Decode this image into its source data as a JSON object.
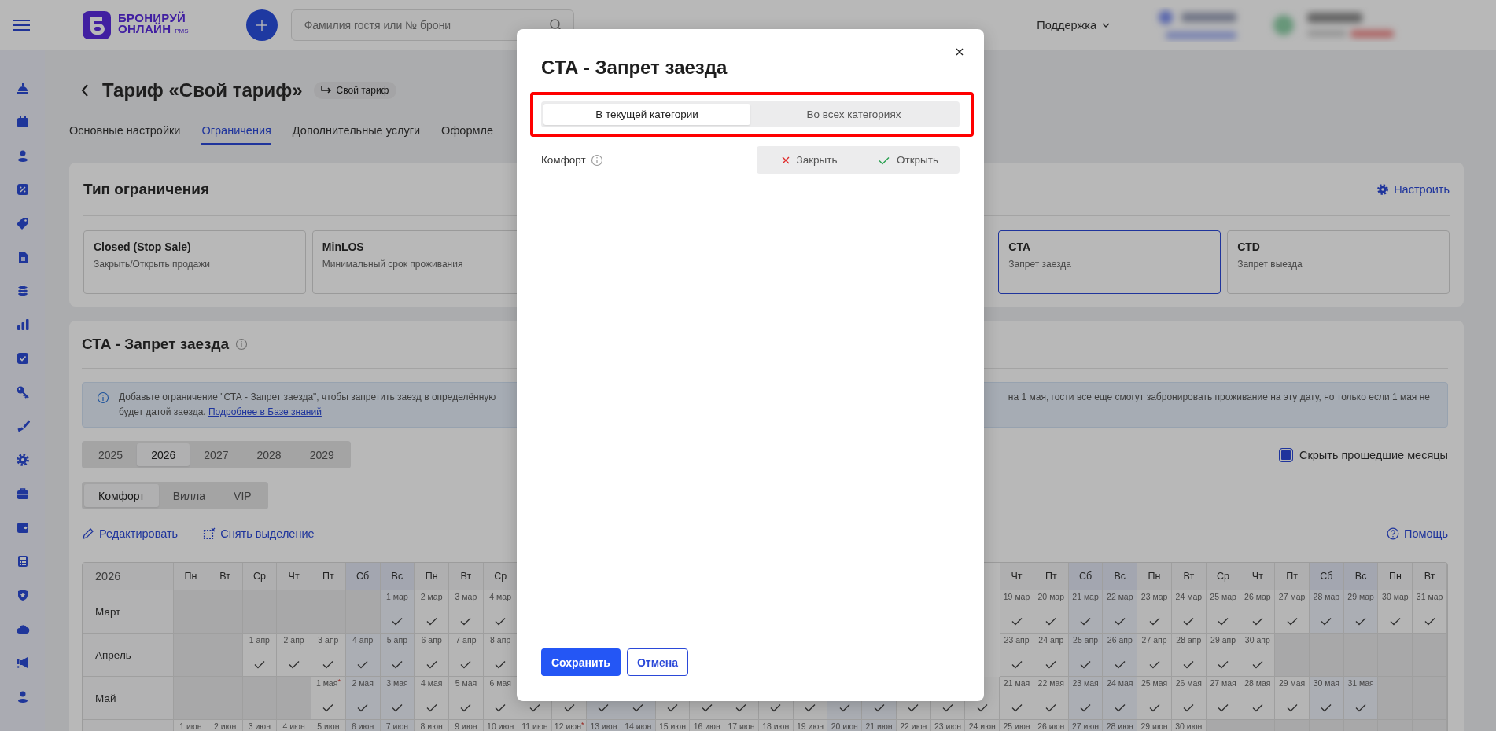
{
  "topbar": {
    "logo": {
      "line1": "БРОНИРУЙ",
      "line2": "ОНЛАЙН",
      "suffix": "PMS"
    },
    "search": {
      "placeholder": "Фамилия гостя или № брони"
    },
    "support": "Поддержка"
  },
  "page": {
    "title": "Тариф «Свой тариф»",
    "chip": "Свой тариф",
    "tabs": [
      {
        "label": "Основные настройки",
        "selected": false
      },
      {
        "label": "Ограничения",
        "selected": true
      },
      {
        "label": "Дополнительные услуги",
        "selected": false
      },
      {
        "label": "Оформле",
        "selected": false
      }
    ]
  },
  "restriction_types": {
    "title": "Тип ограничения",
    "configure": "Настроить",
    "cards_start": [
      {
        "title": "Closed (Stop Sale)",
        "description": "Закрыть/Открыть продажи",
        "selected": false
      },
      {
        "title": "MinLOS",
        "description": "Минимальный срок проживания",
        "selected": false
      }
    ],
    "cards_end": [
      {
        "title": "CTA",
        "description": "Запрет заезда",
        "selected": true
      },
      {
        "title": "CTD",
        "description": "Запрет выезда",
        "selected": false
      }
    ]
  },
  "restriction": {
    "title": "СТА - Запрет заезда",
    "info": {
      "line1_start": "Добавьте ограничение \"СТА - Запрет заезда\", чтобы запретить заезд в определённую",
      "line1_end": "на 1 мая, гости все еще смогут забронировать проживание на эту дату, но только если 1 мая не",
      "line2": "будет датой заезда.",
      "link": "Подробнее в Базе знаний"
    },
    "years": [
      {
        "label": "2025",
        "selected": false
      },
      {
        "label": "2026",
        "selected": true
      },
      {
        "label": "2027",
        "selected": false
      },
      {
        "label": "2028",
        "selected": false
      },
      {
        "label": "2029",
        "selected": false
      }
    ],
    "hide_past": {
      "label": "Скрыть прошедшие месяцы",
      "checked": true
    },
    "categories": [
      {
        "label": "Комфорт",
        "selected": true
      },
      {
        "label": "Вилла",
        "selected": false
      },
      {
        "label": "VIP",
        "selected": false
      }
    ],
    "edit": "Редактировать",
    "clear": "Снять выделение",
    "help": "Помощь",
    "calendar": {
      "year": "2026",
      "header_start": [
        {
          "day": "Пн",
          "weekend": false
        },
        {
          "day": "Вт",
          "weekend": false
        },
        {
          "day": "Ср",
          "weekend": false
        },
        {
          "day": "Чт",
          "weekend": false
        },
        {
          "day": "Пт",
          "weekend": false
        },
        {
          "day": "Сб",
          "weekend": true
        },
        {
          "day": "Вс",
          "weekend": true
        },
        {
          "day": "Пн",
          "weekend": false
        },
        {
          "day": "Вт",
          "weekend": false
        },
        {
          "day": "Ср",
          "weekend": false
        }
      ],
      "header_end": [
        {
          "day": "Чт",
          "weekend": false
        },
        {
          "day": "Пт",
          "weekend": false
        },
        {
          "day": "Сб",
          "weekend": true
        },
        {
          "day": "Вс",
          "weekend": true
        },
        {
          "day": "Пн",
          "weekend": false
        },
        {
          "day": "Вт",
          "weekend": false
        },
        {
          "day": "Ср",
          "weekend": false
        },
        {
          "day": "Чт",
          "weekend": false
        },
        {
          "day": "Пт",
          "weekend": false
        },
        {
          "day": "Сб",
          "weekend": true
        },
        {
          "day": "Вс",
          "weekend": true
        },
        {
          "day": "Пн",
          "weekend": false
        },
        {
          "day": "Вт",
          "weekend": false
        }
      ],
      "rows": [
        {
          "month": "Март",
          "cells": [
            {
              "kind": "empty"
            },
            {
              "kind": "empty"
            },
            {
              "kind": "empty"
            },
            {
              "kind": "empty"
            },
            {
              "kind": "empty"
            },
            {
              "kind": "empty"
            },
            {
              "kind": "day",
              "date": "1 мар",
              "checked": true,
              "weekend": true
            },
            {
              "kind": "day",
              "date": "2 мар",
              "checked": true
            },
            {
              "kind": "day",
              "date": "3 мар",
              "checked": true
            },
            {
              "kind": "day",
              "date": "4 мар",
              "checked": true
            }
          ],
          "cells_end": [
            {
              "kind": "day",
              "date": "19 мар",
              "checked": true
            },
            {
              "kind": "day",
              "date": "20 мар",
              "checked": true
            },
            {
              "kind": "day",
              "date": "21 мар",
              "checked": true,
              "weekend": true
            },
            {
              "kind": "day",
              "date": "22 мар",
              "checked": true,
              "weekend": true
            },
            {
              "kind": "day",
              "date": "23 мар",
              "checked": true
            },
            {
              "kind": "day",
              "date": "24 мар",
              "checked": true
            },
            {
              "kind": "day",
              "date": "25 мар",
              "checked": true
            },
            {
              "kind": "day",
              "date": "26 мар",
              "checked": true
            },
            {
              "kind": "day",
              "date": "27 мар",
              "checked": true
            },
            {
              "kind": "day",
              "date": "28 мар",
              "checked": true,
              "weekend": true
            },
            {
              "kind": "day",
              "date": "29 мар",
              "checked": true,
              "weekend": true
            },
            {
              "kind": "day",
              "date": "30 мар",
              "checked": true
            },
            {
              "kind": "day",
              "date": "31 мар",
              "checked": true
            }
          ]
        },
        {
          "month": "Апрель",
          "cells": [
            {
              "kind": "empty"
            },
            {
              "kind": "empty"
            },
            {
              "kind": "day",
              "date": "1 апр",
              "checked": true
            },
            {
              "kind": "day",
              "date": "2 апр",
              "checked": true
            },
            {
              "kind": "day",
              "date": "3 апр",
              "checked": true
            },
            {
              "kind": "day",
              "date": "4 апр",
              "checked": true,
              "weekend": true
            },
            {
              "kind": "day",
              "date": "5 апр",
              "checked": true,
              "weekend": true
            },
            {
              "kind": "day",
              "date": "6 апр",
              "checked": true
            },
            {
              "kind": "day",
              "date": "7 апр",
              "checked": true
            },
            {
              "kind": "day",
              "date": "8 апр",
              "checked": true
            }
          ],
          "cells_end": [
            {
              "kind": "day",
              "date": "23 апр",
              "checked": true
            },
            {
              "kind": "day",
              "date": "24 апр",
              "checked": true
            },
            {
              "kind": "day",
              "date": "25 апр",
              "checked": true,
              "weekend": true
            },
            {
              "kind": "day",
              "date": "26 апр",
              "checked": true,
              "weekend": true
            },
            {
              "kind": "day",
              "date": "27 апр",
              "checked": true
            },
            {
              "kind": "day",
              "date": "28 апр",
              "checked": true
            },
            {
              "kind": "day",
              "date": "29 апр",
              "checked": true
            },
            {
              "kind": "day",
              "date": "30 апр",
              "checked": true
            },
            {
              "kind": "empty"
            },
            {
              "kind": "empty"
            },
            {
              "kind": "empty"
            },
            {
              "kind": "empty"
            },
            {
              "kind": "empty"
            }
          ]
        },
        {
          "month": "Май",
          "cells": [
            {
              "kind": "empty"
            },
            {
              "kind": "empty"
            },
            {
              "kind": "empty"
            },
            {
              "kind": "empty"
            },
            {
              "kind": "day",
              "date": "1 мая",
              "mark": "*",
              "checked": true
            },
            {
              "kind": "day",
              "date": "2 мая",
              "checked": true,
              "weekend": true
            },
            {
              "kind": "day",
              "date": "3 мая",
              "checked": true,
              "weekend": true
            },
            {
              "kind": "day",
              "date": "4 мая",
              "checked": true
            },
            {
              "kind": "day",
              "date": "5 мая",
              "checked": true
            },
            {
              "kind": "day",
              "date": "6 мая",
              "checked": true
            },
            {
              "kind": "day",
              "checked": true
            },
            {
              "kind": "day",
              "checked": true
            },
            {
              "kind": "day",
              "checked": true,
              "weekend": true
            },
            {
              "kind": "day",
              "checked": true,
              "weekend": true
            },
            {
              "kind": "day",
              "checked": true
            },
            {
              "kind": "day",
              "checked": true
            },
            {
              "kind": "day",
              "checked": true
            },
            {
              "kind": "day",
              "checked": true
            },
            {
              "kind": "day",
              "checked": true
            },
            {
              "kind": "day",
              "checked": true,
              "weekend": true
            },
            {
              "kind": "day",
              "checked": true,
              "weekend": true
            },
            {
              "kind": "day",
              "checked": true
            },
            {
              "kind": "day",
              "checked": true
            },
            {
              "kind": "day",
              "checked": true
            },
            {
              "kind": "day",
              "date": "21 мая",
              "checked": true
            },
            {
              "kind": "day",
              "date": "22 мая",
              "checked": true
            },
            {
              "kind": "day",
              "date": "23 мая",
              "checked": true,
              "weekend": true
            },
            {
              "kind": "day",
              "date": "24 мая",
              "checked": true,
              "weekend": true
            },
            {
              "kind": "day",
              "date": "25 мая",
              "checked": true
            },
            {
              "kind": "day",
              "date": "26 мая",
              "checked": true
            },
            {
              "kind": "day",
              "date": "27 мая",
              "checked": true
            },
            {
              "kind": "day",
              "date": "28 мая",
              "checked": true
            },
            {
              "kind": "day",
              "date": "29 мая",
              "checked": true
            },
            {
              "kind": "day",
              "date": "30 мая",
              "checked": true,
              "weekend": true
            },
            {
              "kind": "day",
              "date": "31 мая",
              "checked": true,
              "weekend": true
            },
            {
              "kind": "empty"
            },
            {
              "kind": "empty"
            }
          ]
        },
        {
          "cells": [
            {
              "kind": "day",
              "date": "1 июн"
            },
            {
              "kind": "day",
              "date": "2 июн"
            },
            {
              "kind": "day",
              "date": "3 июн"
            },
            {
              "kind": "day",
              "date": "4 июн"
            },
            {
              "kind": "day",
              "date": "5 июн"
            },
            {
              "kind": "day",
              "date": "6 июн",
              "weekend": true
            },
            {
              "kind": "day",
              "date": "7 июн",
              "weekend": true
            },
            {
              "kind": "day",
              "date": "8 июн"
            },
            {
              "kind": "day",
              "date": "9 июн"
            },
            {
              "kind": "day",
              "date": "10 июн"
            },
            {
              "kind": "day",
              "date": "11 июн"
            },
            {
              "kind": "day",
              "date": "12 июн",
              "mark": "*"
            },
            {
              "kind": "day",
              "date": "13 июн",
              "weekend": true
            },
            {
              "kind": "day",
              "date": "14 июн",
              "weekend": true
            },
            {
              "kind": "day",
              "date": "15 июн"
            },
            {
              "kind": "day",
              "date": "16 июн"
            },
            {
              "kind": "day",
              "date": "17 июн"
            },
            {
              "kind": "day",
              "date": "18 июн"
            },
            {
              "kind": "day",
              "date": "19 июн"
            },
            {
              "kind": "day",
              "date": "20 июн",
              "weekend": true
            },
            {
              "kind": "day",
              "date": "21 июн",
              "weekend": true
            },
            {
              "kind": "day",
              "date": "22 июн"
            },
            {
              "kind": "day",
              "date": "23 июн"
            },
            {
              "kind": "day",
              "date": "24 июн"
            },
            {
              "kind": "day",
              "date": "25 июн"
            },
            {
              "kind": "day",
              "date": "26 июн"
            },
            {
              "kind": "day",
              "date": "27 июн",
              "weekend": true
            },
            {
              "kind": "day",
              "date": "28 июн",
              "weekend": true
            },
            {
              "kind": "day",
              "date": "29 июн"
            },
            {
              "kind": "day",
              "date": "30 июн"
            },
            {
              "kind": "empty"
            },
            {
              "kind": "empty"
            },
            {
              "kind": "empty"
            },
            {
              "kind": "empty"
            },
            {
              "kind": "empty"
            },
            {
              "kind": "empty"
            },
            {
              "kind": "empty"
            }
          ]
        }
      ]
    }
  },
  "modal": {
    "title": "СТА - Запрет заезда",
    "scope_tabs": [
      {
        "label": "В текущей категории",
        "selected": true
      },
      {
        "label": "Во всех категориях",
        "selected": false
      }
    ],
    "row": {
      "label": "Комфорт",
      "actions": [
        {
          "kind": "close",
          "label": "Закрыть",
          "selected": false
        },
        {
          "kind": "open",
          "label": "Открыть",
          "selected": false
        }
      ]
    },
    "buttons": [
      {
        "kind": "primary",
        "label": "Сохранить"
      },
      {
        "kind": "secondary",
        "label": "Отмена"
      }
    ]
  }
}
